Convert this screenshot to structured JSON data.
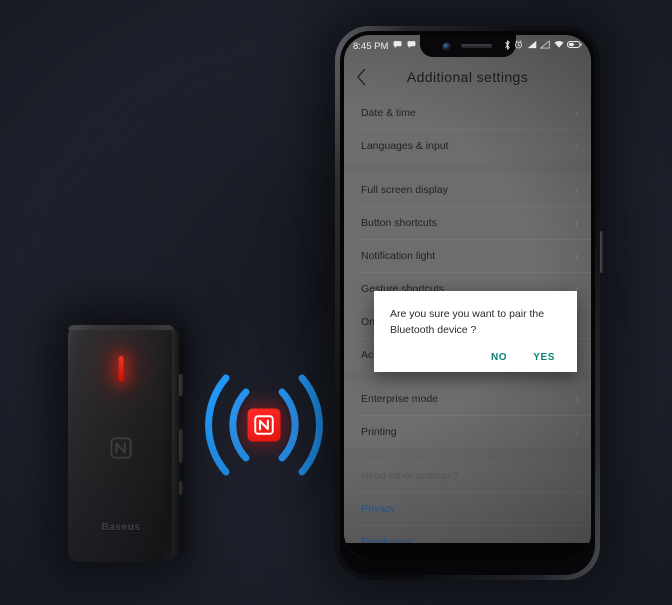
{
  "scene": {
    "background_color": "#22252f",
    "accent_red": "#e8150f",
    "accent_blue": "#2196f3"
  },
  "device": {
    "brand": "Baseus",
    "led_color": "#ff2b1a",
    "nfc_icon": "nfc-logo-icon"
  },
  "nfc_badge": {
    "chip_icon": "nfc-logo-icon",
    "chip_color": "#e8150f",
    "wave_color": "#2196f3",
    "wave_count": 4
  },
  "phone": {
    "status_bar": {
      "time": "8:45 PM",
      "notification_icons": [
        "chat-bubble-icon",
        "chat-bubble-icon"
      ],
      "system_icons": [
        "bluetooth-icon",
        "alarm-icon",
        "signal-bars-icon",
        "signal-bars-secondary-icon",
        "wifi-icon",
        "battery-icon"
      ]
    },
    "app_bar": {
      "back_icon": "back-chevron-icon",
      "title": "Additional  settings"
    },
    "settings": {
      "groups": [
        {
          "items": [
            {
              "label": "Date & time",
              "chevron": "›"
            },
            {
              "label": "Languages & input",
              "chevron": "›"
            }
          ]
        },
        {
          "items": [
            {
              "label": "Full screen display",
              "chevron": "›"
            },
            {
              "label": "Button shortcuts",
              "chevron": "›"
            },
            {
              "label": "Notification light",
              "chevron": "›"
            },
            {
              "label": "Gesture shortcuts",
              "chevron": "›"
            },
            {
              "label": "One-handed mode",
              "chevron": "›"
            },
            {
              "label": "Accessibility",
              "chevron": "›"
            }
          ]
        },
        {
          "items": [
            {
              "label": "Enterprise mode",
              "chevron": "›"
            },
            {
              "label": "Printing",
              "chevron": "›"
            }
          ]
        }
      ],
      "footer": {
        "prompt": "Need other settings?",
        "links": [
          {
            "label": "Privacy"
          },
          {
            "label": "Earphones"
          }
        ]
      }
    },
    "dialog": {
      "message": "Are you sure you want to pair the Bluetooth device ?",
      "negative_label": "NO",
      "positive_label": "YES",
      "action_color": "#0d8174"
    }
  }
}
